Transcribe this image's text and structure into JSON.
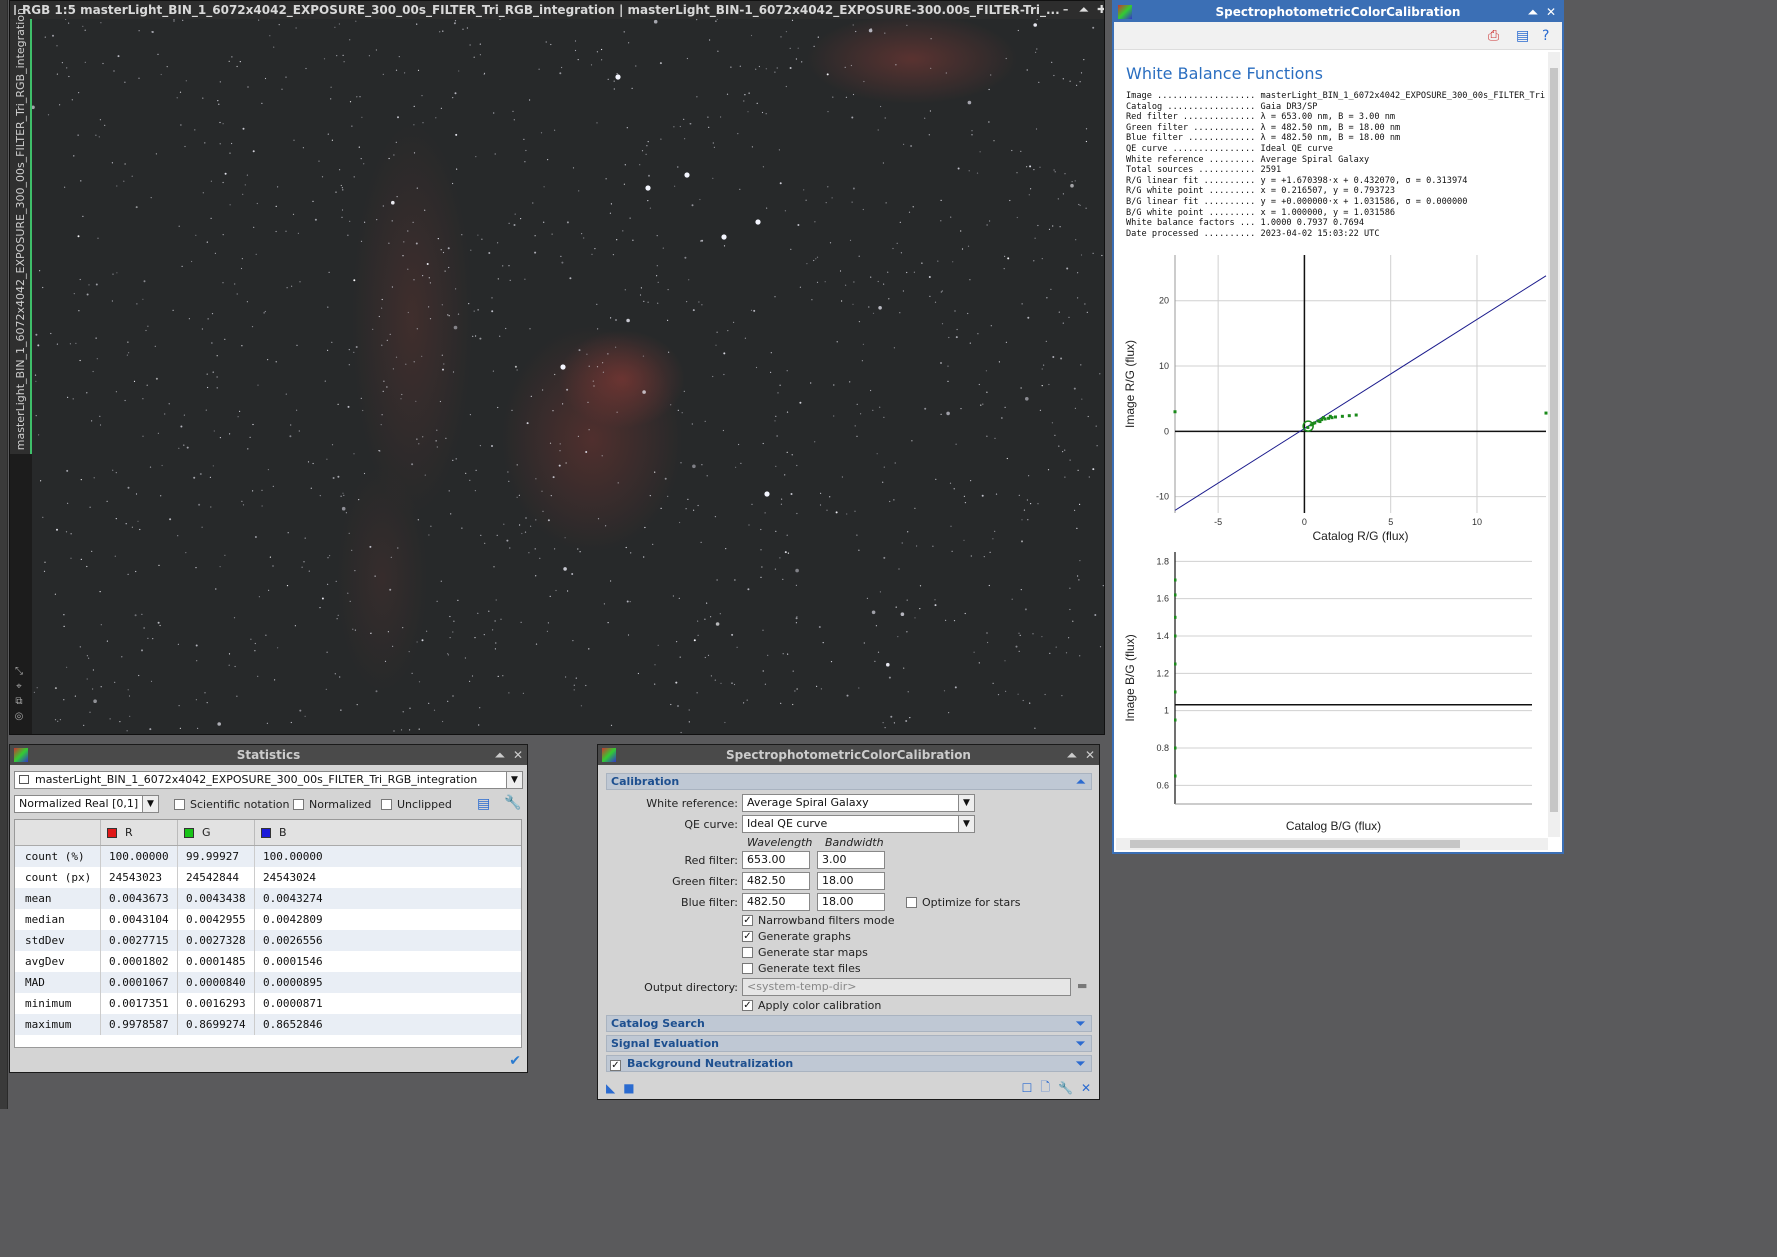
{
  "image_window": {
    "title": "RGB 1:5 masterLight_BIN_1_6072x4042_EXPOSURE_300_00s_FILTER_Tri_RGB_integration | masterLight_BIN-1_6072x4042_EXPOSURE-300.00s_FILTER-Tri_...",
    "side_tab_label": "masterLight_BIN_1_6072x4042_EXPOSURE_300_00s_FILTER_Tri_RGB_integration"
  },
  "statistics": {
    "title": "Statistics",
    "image_selector": "masterLight_BIN_1_6072x4042_EXPOSURE_300_00s_FILTER_Tri_RGB_integration",
    "range": "Normalized Real [0,1]",
    "scientific_notation": "Scientific notation",
    "normalized": "Normalized",
    "unclipped": "Unclipped",
    "columns": [
      "R",
      "G",
      "B"
    ],
    "channel_colors": [
      "#e01818",
      "#18c418",
      "#1818d8"
    ],
    "rows": [
      {
        "label": "count (%)",
        "r": "100.00000",
        "g": "99.99927",
        "b": "100.00000"
      },
      {
        "label": "count (px)",
        "r": "24543023",
        "g": "24542844",
        "b": "24543024"
      },
      {
        "label": "mean",
        "r": "0.0043673",
        "g": "0.0043438",
        "b": "0.0043274"
      },
      {
        "label": "median",
        "r": "0.0043104",
        "g": "0.0042955",
        "b": "0.0042809"
      },
      {
        "label": "stdDev",
        "r": "0.0027715",
        "g": "0.0027328",
        "b": "0.0026556"
      },
      {
        "label": "avgDev",
        "r": "0.0001802",
        "g": "0.0001485",
        "b": "0.0001546"
      },
      {
        "label": "MAD",
        "r": "0.0001067",
        "g": "0.0000840",
        "b": "0.0000895"
      },
      {
        "label": "minimum",
        "r": "0.0017351",
        "g": "0.0016293",
        "b": "0.0000871"
      },
      {
        "label": "maximum",
        "r": "0.9978587",
        "g": "0.8699274",
        "b": "0.8652846"
      }
    ]
  },
  "spcc": {
    "title": "SpectrophotometricColorCalibration",
    "sections": {
      "calibration": "Calibration",
      "catalog_search": "Catalog Search",
      "signal_evaluation": "Signal Evaluation",
      "background_neutralization": "Background Neutralization"
    },
    "white_reference_label": "White reference:",
    "white_reference_value": "Average Spiral Galaxy",
    "qe_curve_label": "QE curve:",
    "qe_curve_value": "Ideal QE curve",
    "wavelength_header": "Wavelength",
    "bandwidth_header": "Bandwidth",
    "red_filter_label": "Red filter:",
    "red_wavelength": "653.00",
    "red_bandwidth": "3.00",
    "green_filter_label": "Green filter:",
    "green_wavelength": "482.50",
    "green_bandwidth": "18.00",
    "blue_filter_label": "Blue filter:",
    "blue_wavelength": "482.50",
    "blue_bandwidth": "18.00",
    "optimize_for_stars": "Optimize for stars",
    "narrowband_filters_mode": "Narrowband filters mode",
    "generate_graphs": "Generate graphs",
    "generate_star_maps": "Generate star maps",
    "generate_text_files": "Generate text files",
    "output_directory_label": "Output directory:",
    "output_directory_placeholder": "<system-temp-dir>",
    "apply_color_calibration": "Apply color calibration"
  },
  "graph_window": {
    "title": "SpectrophotometricColorCalibration",
    "heading": "White Balance Functions",
    "report": [
      "Image ................... masterLight_BIN_1_6072x4042_EXPOSURE_300_00s_FILTER_Tri",
      "Catalog ................. Gaia DR3/SP",
      "Red filter .............. λ = 653.00 nm, B = 3.00 nm",
      "Green filter ............ λ = 482.50 nm, B = 18.00 nm",
      "Blue filter ............. λ = 482.50 nm, B = 18.00 nm",
      "QE curve ................ Ideal QE curve",
      "White reference ......... Average Spiral Galaxy",
      "Total sources ........... 2591",
      "R/G linear fit .......... y = +1.670398·x + 0.432070, σ = 0.313974",
      "R/G white point ......... x = 0.216507, y = 0.793723",
      "B/G linear fit .......... y = +0.000000·x + 1.031586, σ = 0.000000",
      "B/G white point ......... x = 1.000000, y = 1.031586",
      "White balance factors ... 1.0000 0.7937 0.7694",
      "Date processed .......... 2023-04-02 15:03:22 UTC"
    ]
  },
  "chart_data": [
    {
      "type": "scatter",
      "xlabel": "Catalog R/G (flux)",
      "ylabel": "Image R/G (flux)",
      "xlim": [
        -7.5,
        14
      ],
      "ylim": [
        -12.5,
        27
      ],
      "xticks": [
        -5,
        0,
        5,
        10
      ],
      "yticks": [
        -10,
        0,
        10,
        20
      ],
      "fit_line": {
        "slope": 1.670398,
        "intercept": 0.43207,
        "color": "#1a1a8c"
      },
      "white_point": [
        0.216507,
        0.793723
      ],
      "points_color": "#1a8a1a",
      "points": [
        [
          0.2,
          0.6
        ],
        [
          0.4,
          1.0
        ],
        [
          0.6,
          1.3
        ],
        [
          0.8,
          1.6
        ],
        [
          1.0,
          1.8
        ],
        [
          1.2,
          1.9
        ],
        [
          1.4,
          2.0
        ],
        [
          1.6,
          2.1
        ],
        [
          1.8,
          2.2
        ],
        [
          2.2,
          2.3
        ],
        [
          2.6,
          2.4
        ],
        [
          3.0,
          2.5
        ],
        [
          0.5,
          1.2
        ],
        [
          0.9,
          1.5
        ],
        [
          1.1,
          2.1
        ],
        [
          1.5,
          2.3
        ],
        [
          -7.5,
          3.0
        ],
        [
          14.0,
          2.8
        ]
      ]
    },
    {
      "type": "scatter",
      "xlabel": "Catalog B/G (flux)",
      "ylabel": "Image B/G (flux)",
      "ylim": [
        0.5,
        1.85
      ],
      "yticks": [
        0.6,
        0.8,
        1.0,
        1.2,
        1.4,
        1.6,
        1.8
      ],
      "fit_line": {
        "slope": 0.0,
        "intercept": 1.031586,
        "color": "#111111"
      },
      "points_color": "#1a8a1a",
      "points": [
        [
          0,
          0.65
        ],
        [
          0,
          0.8
        ],
        [
          0,
          0.95
        ],
        [
          0,
          1.1
        ],
        [
          0,
          1.25
        ],
        [
          0,
          1.4
        ],
        [
          0,
          1.5
        ],
        [
          0,
          1.62
        ],
        [
          0,
          1.7
        ]
      ]
    }
  ]
}
